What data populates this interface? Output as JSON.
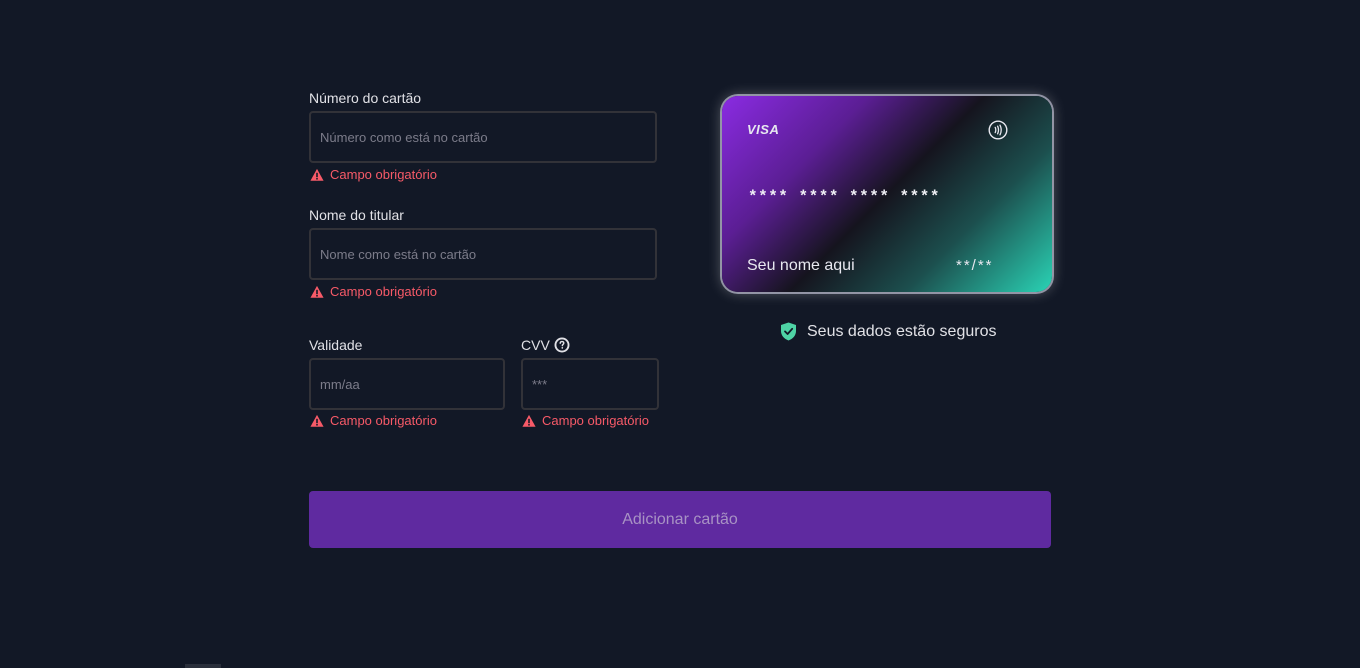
{
  "form": {
    "card_number": {
      "label": "Número do cartão",
      "placeholder": "Número como está no cartão",
      "value": "",
      "error": "Campo obrigatório"
    },
    "holder_name": {
      "label": "Nome do titular",
      "placeholder": "Nome como está no cartão",
      "value": "",
      "error": "Campo obrigatório"
    },
    "expiry": {
      "label": "Validade",
      "placeholder": "mm/aa",
      "value": "",
      "error": "Campo obrigatório"
    },
    "cvv": {
      "label": "CVV",
      "placeholder": "***",
      "value": "",
      "error": "Campo obrigatório",
      "help_icon": "question-circle-icon"
    }
  },
  "card_preview": {
    "brand": "VISA",
    "contactless_icon": "contactless-icon",
    "number": "**** **** **** ****",
    "holder": "Seu nome aqui",
    "expiry": "**/**"
  },
  "security_note": {
    "icon": "shield-check-icon",
    "text": "Seus dados estão seguros",
    "icon_color": "#4ed3a5"
  },
  "submit": {
    "label": "Adicionar cartão"
  },
  "colors": {
    "background": "#121826",
    "error": "#f75a68",
    "button": "#5f2aa0",
    "card_gradient_start": "#8a2be2",
    "card_gradient_end": "#2ad3b5"
  }
}
